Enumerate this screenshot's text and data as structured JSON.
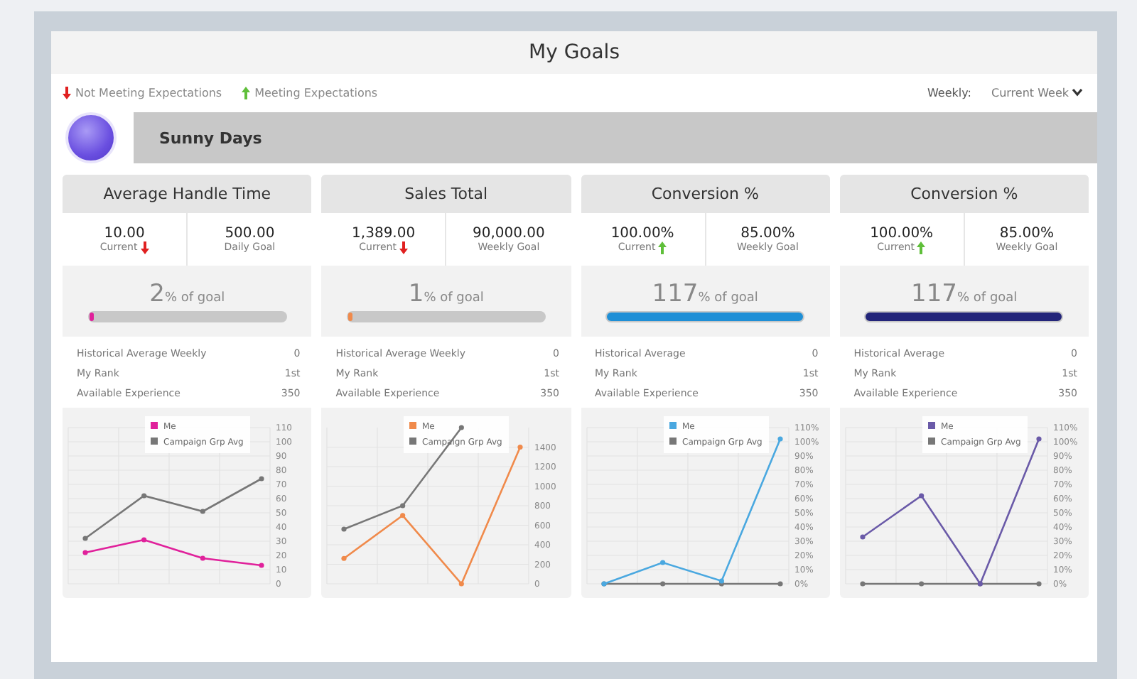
{
  "title": "My Goals",
  "legend": [
    {
      "kind": "down",
      "label": "Not Meeting Expectations"
    },
    {
      "kind": "up",
      "label": "Meeting Expectations"
    }
  ],
  "period": {
    "label": "Weekly:",
    "value": "Current Week"
  },
  "team": {
    "name": "Sunny Days"
  },
  "cards": [
    {
      "title": "Average Handle Time",
      "current": {
        "value": "10.00",
        "label": "Current",
        "kind": "down"
      },
      "goal": {
        "value": "500.00",
        "label": "Daily Goal"
      },
      "percent": "2",
      "percent_label": "% of goal",
      "level": 0.02,
      "color": "#e0219b",
      "stats": [
        {
          "label": "Historical Average Weekly",
          "value": "0"
        },
        {
          "label": "My Rank",
          "value": "1st"
        },
        {
          "label": "Available Experience",
          "value": "350"
        }
      ],
      "chart_data": {
        "type": "line",
        "grid": true,
        "legend": true,
        "ylim": [
          0,
          110
        ],
        "yticks": [
          0,
          10,
          20,
          30,
          40,
          50,
          60,
          70,
          80,
          90,
          100,
          110
        ],
        "series": [
          {
            "name": "Me",
            "color": "#e0219b",
            "marker": "circle",
            "values": [
              22,
              31,
              18,
              13
            ]
          },
          {
            "name": "Campaign Grp Avg",
            "color": "#777777",
            "marker": "circle",
            "values": [
              32,
              62,
              51,
              74
            ]
          }
        ]
      }
    },
    {
      "title": "Sales Total",
      "current": {
        "value": "1,389.00",
        "label": "Current",
        "kind": "down"
      },
      "goal": {
        "value": "90,000.00",
        "label": "Weekly Goal"
      },
      "percent": "1",
      "percent_label": "% of goal",
      "level": 0.01,
      "color": "#f08a4b",
      "stats": [
        {
          "label": "Historical Average Weekly",
          "value": "0"
        },
        {
          "label": "My Rank",
          "value": "1st"
        },
        {
          "label": "Available Experience",
          "value": "350"
        }
      ],
      "chart_data": {
        "type": "line",
        "grid": true,
        "legend": true,
        "ylim": [
          0,
          1600
        ],
        "yticks": [
          0,
          200,
          400,
          600,
          800,
          1000,
          1200,
          1400
        ],
        "series": [
          {
            "name": "Me",
            "color": "#f08a4b",
            "marker": "circle",
            "values": [
              260,
              700,
              0,
              1400
            ]
          },
          {
            "name": "Campaign Grp Avg",
            "color": "#777777",
            "marker": "circle",
            "values": [
              560,
              800,
              1600,
              null
            ]
          }
        ]
      }
    },
    {
      "title": "Conversion %",
      "current": {
        "value": "100.00%",
        "label": "Current",
        "kind": "up"
      },
      "goal": {
        "value": "85.00%",
        "label": "Weekly Goal"
      },
      "percent": "117",
      "percent_label": "% of goal",
      "level": 1,
      "color": "#1f8fd6",
      "stats": [
        {
          "label": "Historical Average",
          "value": "0"
        },
        {
          "label": "My Rank",
          "value": "1st"
        },
        {
          "label": "Available Experience",
          "value": "350"
        }
      ],
      "chart_data": {
        "type": "line",
        "grid": true,
        "legend": true,
        "ylim": [
          0,
          110
        ],
        "yticks": [
          {
            "value": 0,
            "label": "0%"
          },
          {
            "value": 10,
            "label": "10%"
          },
          {
            "value": 20,
            "label": "20%"
          },
          {
            "value": 30,
            "label": "30%"
          },
          {
            "value": 40,
            "label": "40%"
          },
          {
            "value": 50,
            "label": "50%"
          },
          {
            "value": 60,
            "label": "60%"
          },
          {
            "value": 70,
            "label": "70%"
          },
          {
            "value": 80,
            "label": "80%"
          },
          {
            "value": 90,
            "label": "90%"
          },
          {
            "value": 100,
            "label": "100%"
          },
          {
            "value": 110,
            "label": "110%"
          }
        ],
        "series": [
          {
            "name": "Me",
            "color": "#4aa8e0",
            "marker": "circle",
            "values": [
              0,
              15,
              2,
              102
            ]
          },
          {
            "name": "Campaign Grp Avg",
            "color": "#777777",
            "marker": "circle",
            "values": [
              0,
              0,
              0,
              0
            ]
          }
        ]
      }
    },
    {
      "title": "Conversion %",
      "current": {
        "value": "100.00%",
        "label": "Current",
        "kind": "up"
      },
      "goal": {
        "value": "85.00%",
        "label": "Weekly Goal"
      },
      "percent": "117",
      "percent_label": "% of goal",
      "level": 1,
      "color": "#23257a",
      "stats": [
        {
          "label": "Historical Average",
          "value": "0"
        },
        {
          "label": "My Rank",
          "value": "1st"
        },
        {
          "label": "Available Experience",
          "value": "350"
        }
      ],
      "chart_data": {
        "type": "line",
        "grid": true,
        "legend": true,
        "ylim": [
          0,
          110
        ],
        "yticks": [
          {
            "value": 0,
            "label": "0%"
          },
          {
            "value": 10,
            "label": "10%"
          },
          {
            "value": 20,
            "label": "20%"
          },
          {
            "value": 30,
            "label": "30%"
          },
          {
            "value": 40,
            "label": "40%"
          },
          {
            "value": 50,
            "label": "50%"
          },
          {
            "value": 60,
            "label": "60%"
          },
          {
            "value": 70,
            "label": "70%"
          },
          {
            "value": 80,
            "label": "80%"
          },
          {
            "value": 90,
            "label": "90%"
          },
          {
            "value": 100,
            "label": "100%"
          },
          {
            "value": 110,
            "label": "110%"
          }
        ],
        "series": [
          {
            "name": "Me",
            "color": "#6a5aa8",
            "marker": "circle",
            "values": [
              33,
              62,
              0,
              102
            ]
          },
          {
            "name": "Campaign Grp Avg",
            "color": "#777777",
            "marker": "circle",
            "values": [
              0,
              0,
              0,
              0
            ]
          }
        ]
      }
    }
  ]
}
